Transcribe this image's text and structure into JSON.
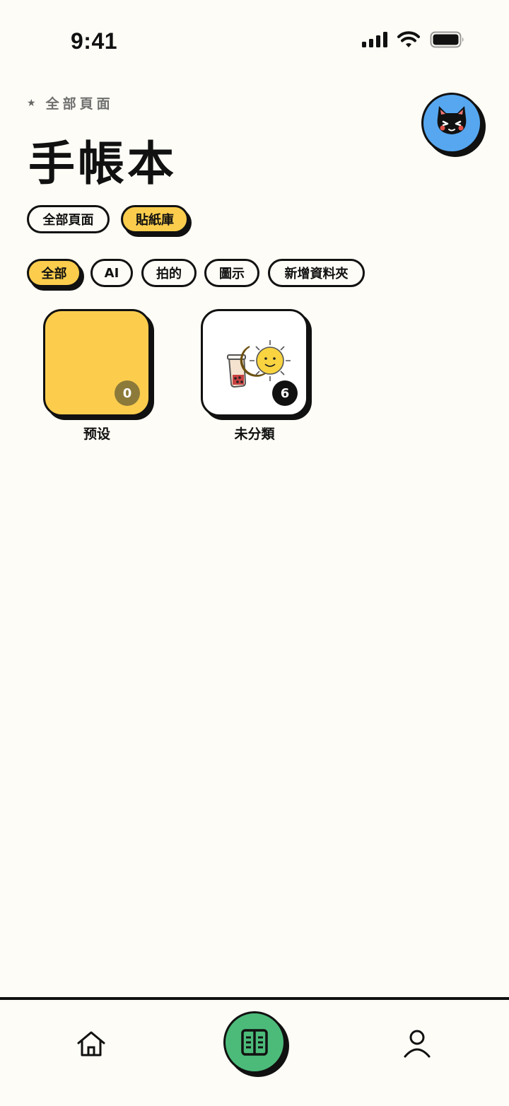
{
  "status_bar": {
    "time": "9:41"
  },
  "breadcrumb": {
    "icon": "star-icon",
    "label": "全部頁面"
  },
  "title": "手帳本",
  "avatar": {
    "icon": "cat-face-icon",
    "background": "#56A7F0"
  },
  "view_tabs": [
    {
      "label": "全部頁面",
      "active": false
    },
    {
      "label": "貼紙庫",
      "active": true
    }
  ],
  "filter_chips": [
    {
      "label": "全部",
      "active": true
    },
    {
      "label": "AI",
      "active": false
    },
    {
      "label": "拍的",
      "active": false
    },
    {
      "label": "圖示",
      "active": false
    },
    {
      "label": "新增資料夾",
      "active": false
    }
  ],
  "folders": [
    {
      "label": "预设",
      "count": "0",
      "tile_color": "#FCCD4D",
      "badge_color": "#8C7A3A"
    },
    {
      "label": "未分類",
      "count": "6",
      "tile_color": "#FFFFFF",
      "badge_color": "#111111",
      "preview_icons": [
        "bubble-tea-icon",
        "moon-icon",
        "sun-icon"
      ]
    }
  ],
  "tab_bar": {
    "items": [
      {
        "icon": "home-icon"
      },
      {
        "icon": "notebook-icon",
        "background": "#4CBB7A"
      },
      {
        "icon": "person-icon"
      }
    ]
  },
  "colors": {
    "background": "#FEFCF6",
    "accent_yellow": "#FCCD4D",
    "accent_green": "#4CBB7A",
    "ink": "#111111"
  }
}
